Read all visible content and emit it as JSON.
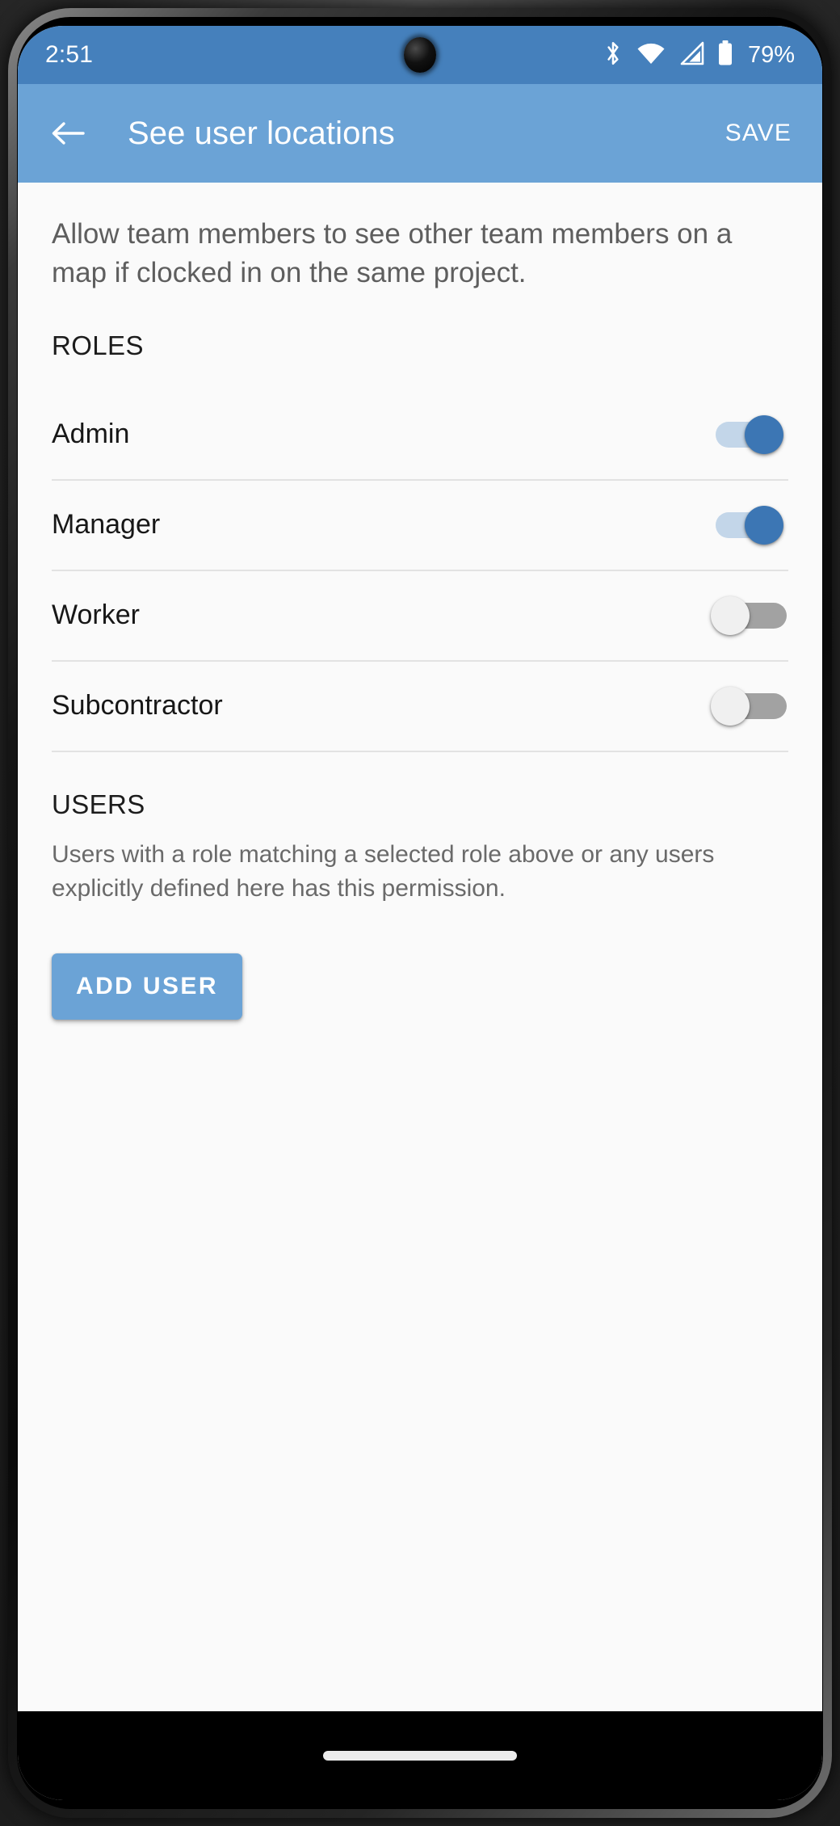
{
  "status_bar": {
    "clock": "2:51",
    "battery_percent": "79%",
    "icons": [
      "bluetooth-icon",
      "wifi-icon",
      "cellular-signal-icon",
      "battery-icon"
    ]
  },
  "app_bar": {
    "back_label": "back-arrow-icon",
    "title": "See user locations",
    "save_label": "SAVE"
  },
  "content": {
    "description": "Allow team members to see other team members on a map if clocked in on the same project.",
    "roles_header": "ROLES",
    "roles": [
      {
        "label": "Admin",
        "enabled": true
      },
      {
        "label": "Manager",
        "enabled": true
      },
      {
        "label": "Worker",
        "enabled": false
      },
      {
        "label": "Subcontractor",
        "enabled": false
      }
    ],
    "users_header": "USERS",
    "users_description": "Users with a role matching a selected role above or any users explicitly defined here has this permission.",
    "add_user_label": "ADD USER"
  },
  "nav_bar": {
    "gesture_pill": "gesture-pill"
  },
  "colors": {
    "status_bar_blue": "#4580bc",
    "app_bar_blue": "#6ba3d6",
    "accent_blue": "#6ba3d6",
    "switch_on_thumb": "#3c76b4",
    "switch_on_track": "#c3d6e9",
    "switch_off_track": "#a2a2a2",
    "switch_off_thumb": "#f0f0f0",
    "content_bg": "#fafafa",
    "divider": "#e2e2e2",
    "primary_text": "#171717",
    "secondary_text": "#5e5e5e"
  }
}
